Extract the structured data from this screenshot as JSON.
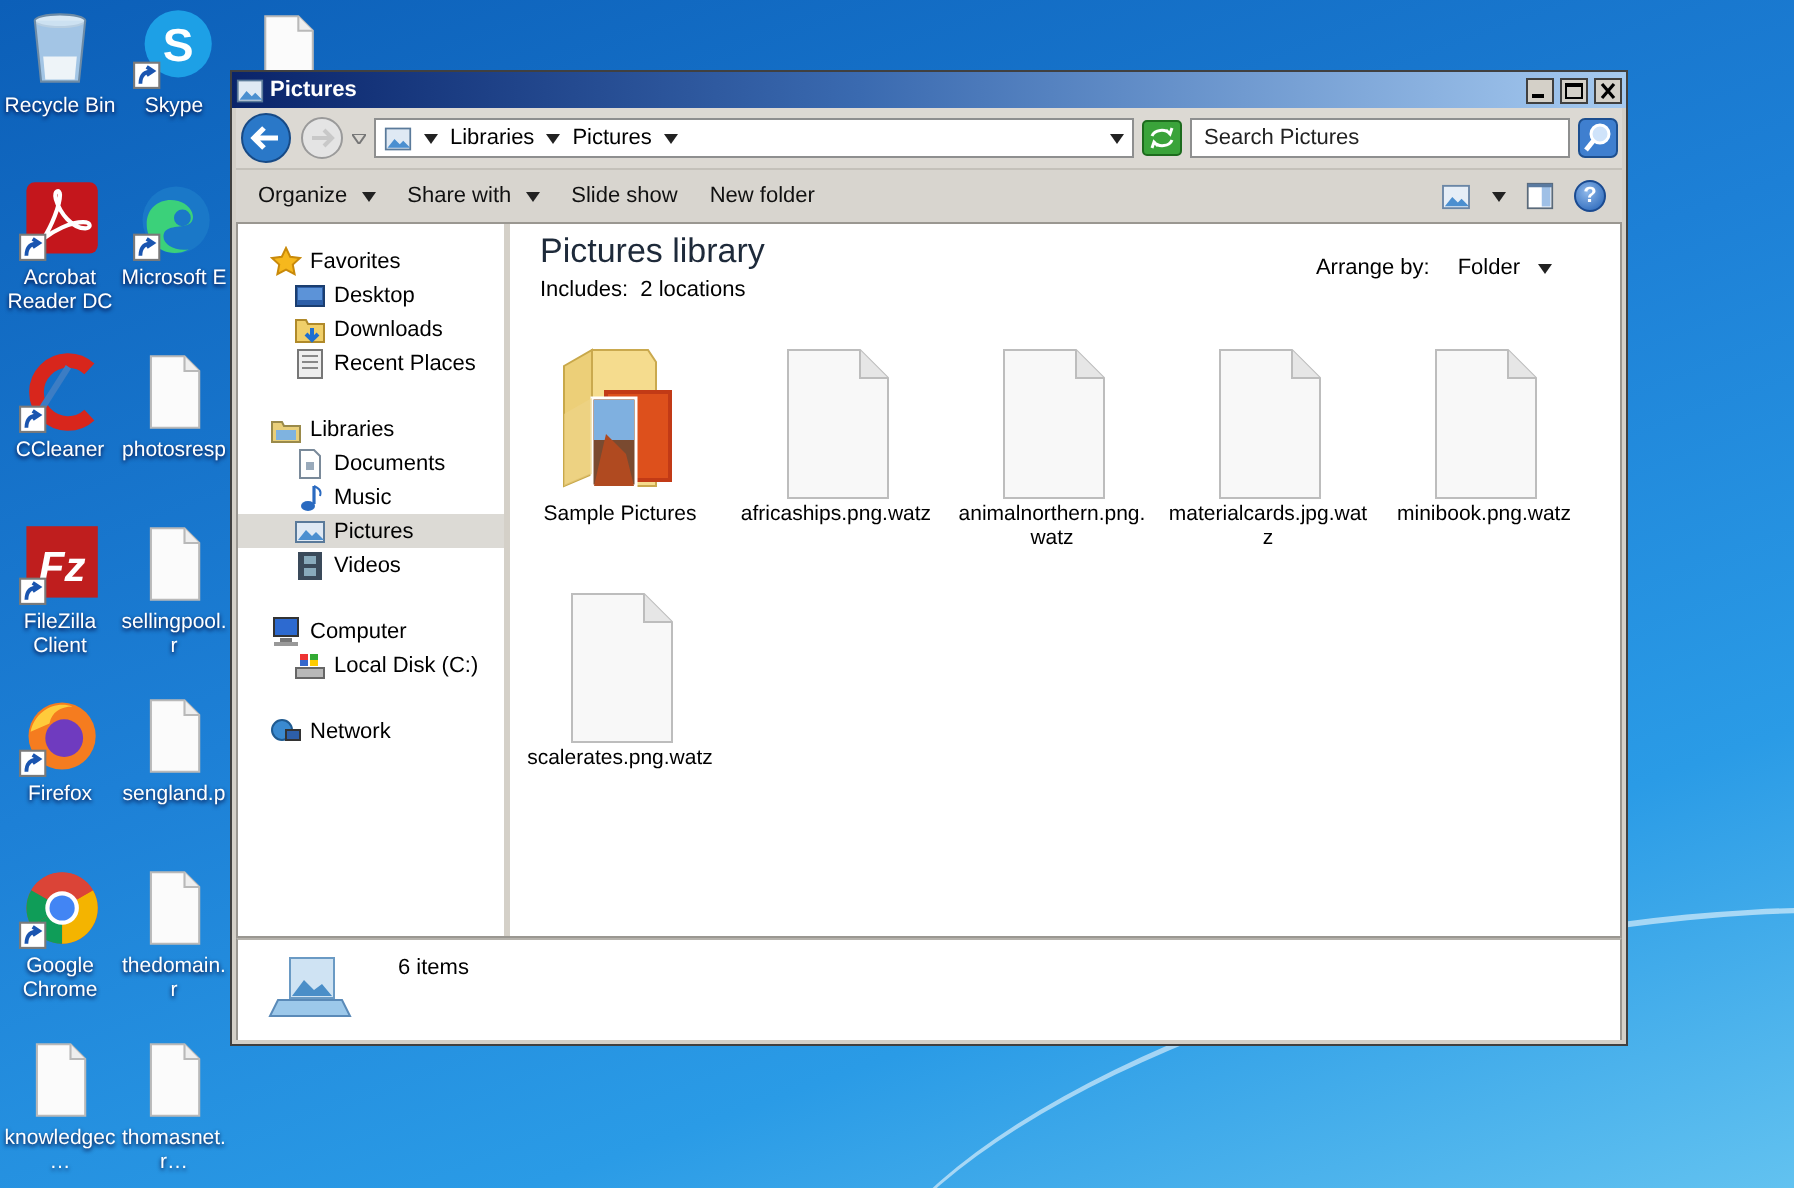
{
  "desktop": {
    "icons": [
      {
        "kind": "recycle-bin",
        "label": "Recycle Bin",
        "shortcut": false
      },
      {
        "kind": "acrobat",
        "label": "Acrobat Reader DC",
        "shortcut": true
      },
      {
        "kind": "ccleaner",
        "label": "CCleaner",
        "shortcut": true
      },
      {
        "kind": "filezilla",
        "glyph": "Fz",
        "label": "FileZilla Client",
        "shortcut": true
      },
      {
        "kind": "firefox",
        "label": "Firefox",
        "shortcut": true
      },
      {
        "kind": "chrome",
        "label": "Google Chrome",
        "shortcut": true
      },
      {
        "kind": "file",
        "label": "knowledgec…",
        "shortcut": false
      },
      {
        "kind": "skype",
        "glyph": "S",
        "label": "Skype",
        "shortcut": true
      },
      {
        "kind": "edge",
        "label": "Microsoft E",
        "shortcut": true
      },
      {
        "kind": "file",
        "label": "photosresp",
        "shortcut": false
      },
      {
        "kind": "file",
        "label": "sellingpool.r",
        "shortcut": false
      },
      {
        "kind": "file",
        "label": "sengland.p",
        "shortcut": false
      },
      {
        "kind": "file",
        "label": "thedomain.r",
        "shortcut": false
      },
      {
        "kind": "file",
        "label": "thomasnet.r…",
        "shortcut": false
      },
      {
        "kind": "file-top",
        "shortcut": false
      }
    ]
  },
  "window": {
    "title": "Pictures",
    "address": {
      "breadcrumb": [
        "Libraries",
        "Pictures"
      ]
    },
    "search": {
      "placeholder": "Search Pictures"
    },
    "toolbar": [
      {
        "label": "Organize",
        "dropdown": true
      },
      {
        "label": "Share with",
        "dropdown": true
      },
      {
        "label": "Slide show",
        "dropdown": false
      },
      {
        "label": "New folder",
        "dropdown": false
      }
    ],
    "help_glyph": "?",
    "navigation": [
      {
        "label": "Favorites",
        "kind": "star",
        "selected": false,
        "children": [
          {
            "label": "Desktop",
            "kind": "desktop",
            "selected": false
          },
          {
            "label": "Downloads",
            "kind": "downloads",
            "selected": false
          },
          {
            "label": "Recent Places",
            "kind": "recent",
            "selected": false
          }
        ]
      },
      {
        "label": "Libraries",
        "kind": "library",
        "selected": false,
        "children": [
          {
            "label": "Documents",
            "kind": "documents",
            "selected": false
          },
          {
            "label": "Music",
            "kind": "music",
            "selected": false
          },
          {
            "label": "Pictures",
            "kind": "pictures",
            "selected": true
          },
          {
            "label": "Videos",
            "kind": "videos",
            "selected": false
          }
        ]
      },
      {
        "label": "Computer",
        "kind": "computer",
        "selected": false,
        "children": [
          {
            "label": "Local Disk (C:)",
            "kind": "disk",
            "selected": false
          }
        ]
      },
      {
        "label": "Network",
        "kind": "network",
        "selected": false
      }
    ],
    "library": {
      "title": "Pictures library",
      "includes": "Includes:  2 locations",
      "arrange_label": "Arrange by:",
      "arrange_value": "Folder"
    },
    "files": [
      {
        "name": "Sample Pictures",
        "kind": "folder"
      },
      {
        "name": "africaships.png.watz",
        "kind": "file"
      },
      {
        "name": "animalnorthern.png.watz",
        "kind": "file"
      },
      {
        "name": "materialcards.jpg.watz",
        "kind": "file"
      },
      {
        "name": "minibook.png.watz",
        "kind": "file"
      },
      {
        "name": "scalerates.png.watz",
        "kind": "file"
      }
    ],
    "details": {
      "count": "6 items"
    }
  }
}
